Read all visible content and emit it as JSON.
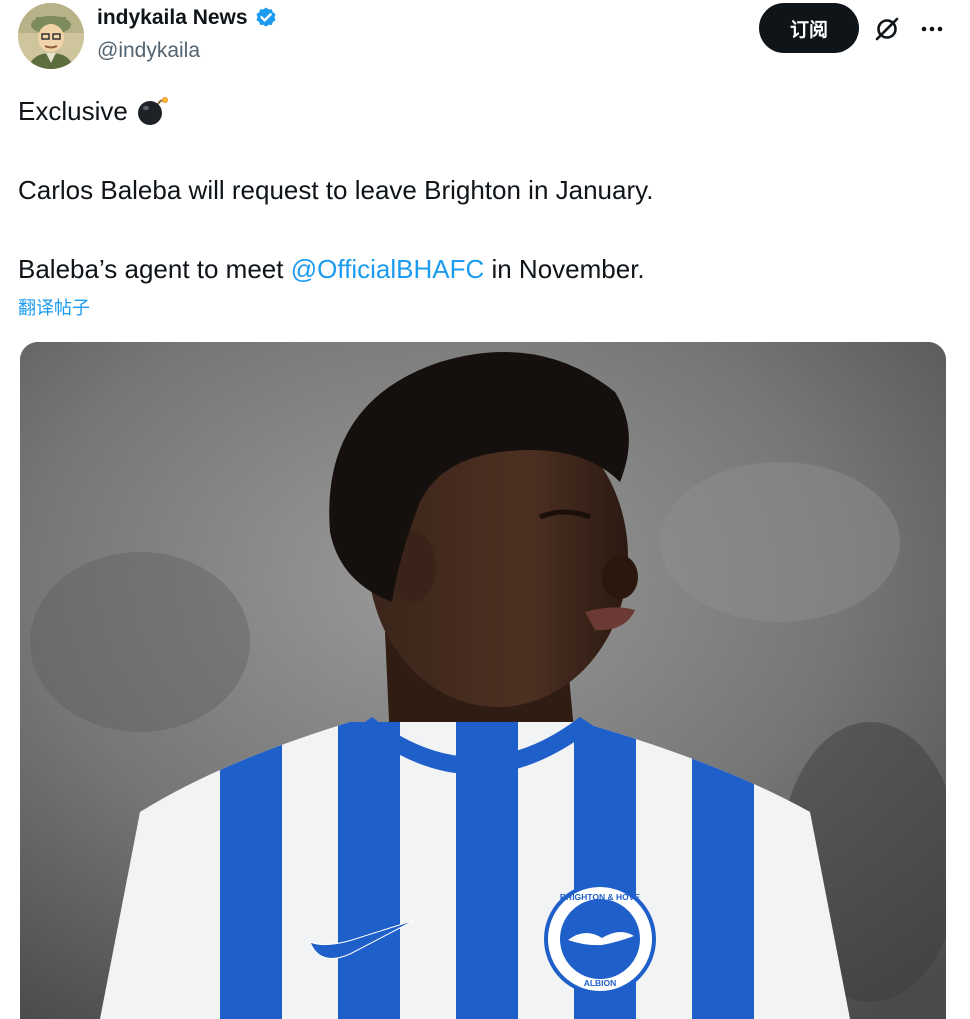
{
  "author": {
    "display_name": "indykaila News",
    "handle": "@indykaila",
    "verified": true,
    "avatar_icon": "cartoon-avatar-icon"
  },
  "actions": {
    "subscribe_label": "订阅",
    "grok_icon": "grok-icon",
    "more_icon": "more-dots-icon"
  },
  "tweet": {
    "line1": "Exclusive",
    "line1_emoji": "bomb-icon",
    "line2": "Carlos Baleba will request to leave Brighton in January.",
    "line3_before": "Baleba’s agent to meet ",
    "line3_mention": "@OfficialBHAFC",
    "line3_after": " in November.",
    "translate_label": "翻译帖子"
  },
  "media": {
    "description_icon": "player-photo",
    "badge_top_text": "BRIGHTON & HOVE",
    "badge_bottom_text": "ALBION"
  },
  "colors": {
    "link": "#1d9bf0",
    "text": "#0f1419",
    "secondary": "#536471",
    "verified": "#1d9bf0",
    "jersey_blue": "#1f5fc9"
  }
}
